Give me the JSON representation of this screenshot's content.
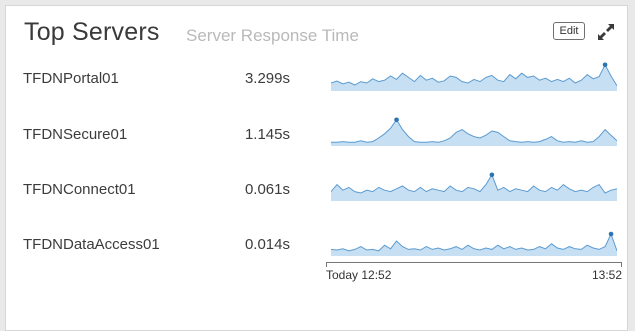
{
  "widget": {
    "title": "Top Servers",
    "subtitle": "Server Response Time",
    "edit_label": "Edit",
    "expand_icon": "expand-arrows-icon"
  },
  "colors": {
    "spark_fill": "#c6dff2",
    "spark_line": "#5b9bd1",
    "marker": "#2b73b3"
  },
  "rows": [
    {
      "name": "TFDNPortal01",
      "value": "3.299s",
      "spark": [
        0.25,
        0.32,
        0.22,
        0.28,
        0.18,
        0.3,
        0.25,
        0.4,
        0.3,
        0.35,
        0.5,
        0.38,
        0.6,
        0.45,
        0.3,
        0.52,
        0.35,
        0.42,
        0.28,
        0.33,
        0.5,
        0.45,
        0.3,
        0.25,
        0.38,
        0.3,
        0.45,
        0.52,
        0.35,
        0.3,
        0.55,
        0.4,
        0.6,
        0.45,
        0.5,
        0.35,
        0.42,
        0.3,
        0.38,
        0.3,
        0.42,
        0.25,
        0.35,
        0.55,
        0.4,
        0.48,
        0.9,
        0.5,
        0.15
      ],
      "peak_index": 46
    },
    {
      "name": "TFDNSecure01",
      "value": "1.145s",
      "spark": [
        0.1,
        0.1,
        0.12,
        0.1,
        0.1,
        0.15,
        0.1,
        0.12,
        0.25,
        0.4,
        0.6,
        0.9,
        0.55,
        0.3,
        0.12,
        0.1,
        0.1,
        0.12,
        0.1,
        0.15,
        0.25,
        0.45,
        0.55,
        0.4,
        0.3,
        0.25,
        0.35,
        0.5,
        0.45,
        0.3,
        0.15,
        0.12,
        0.1,
        0.12,
        0.1,
        0.12,
        0.2,
        0.3,
        0.15,
        0.1,
        0.12,
        0.1,
        0.15,
        0.1,
        0.12,
        0.3,
        0.55,
        0.35,
        0.15
      ],
      "peak_index": 11
    },
    {
      "name": "TFDNConnect01",
      "value": "0.061s",
      "spark": [
        0.3,
        0.55,
        0.35,
        0.45,
        0.3,
        0.25,
        0.35,
        0.3,
        0.45,
        0.35,
        0.3,
        0.4,
        0.5,
        0.35,
        0.3,
        0.45,
        0.3,
        0.4,
        0.35,
        0.3,
        0.5,
        0.35,
        0.3,
        0.45,
        0.4,
        0.3,
        0.55,
        0.9,
        0.35,
        0.45,
        0.3,
        0.4,
        0.35,
        0.3,
        0.5,
        0.35,
        0.3,
        0.45,
        0.35,
        0.55,
        0.4,
        0.3,
        0.35,
        0.3,
        0.45,
        0.55,
        0.25,
        0.35,
        0.4
      ],
      "peak_index": 27
    },
    {
      "name": "TFDNDataAccess01",
      "value": "0.014s",
      "spark": [
        0.2,
        0.18,
        0.22,
        0.15,
        0.2,
        0.3,
        0.18,
        0.2,
        0.15,
        0.35,
        0.22,
        0.5,
        0.3,
        0.2,
        0.22,
        0.18,
        0.3,
        0.2,
        0.25,
        0.18,
        0.22,
        0.3,
        0.2,
        0.35,
        0.22,
        0.18,
        0.25,
        0.2,
        0.35,
        0.22,
        0.3,
        0.2,
        0.25,
        0.18,
        0.2,
        0.3,
        0.22,
        0.4,
        0.25,
        0.2,
        0.3,
        0.22,
        0.2,
        0.35,
        0.25,
        0.2,
        0.3,
        0.75,
        0.15
      ],
      "peak_index": 47
    }
  ],
  "axis": {
    "start_label": "Today 12:52",
    "end_label": "13:52"
  }
}
